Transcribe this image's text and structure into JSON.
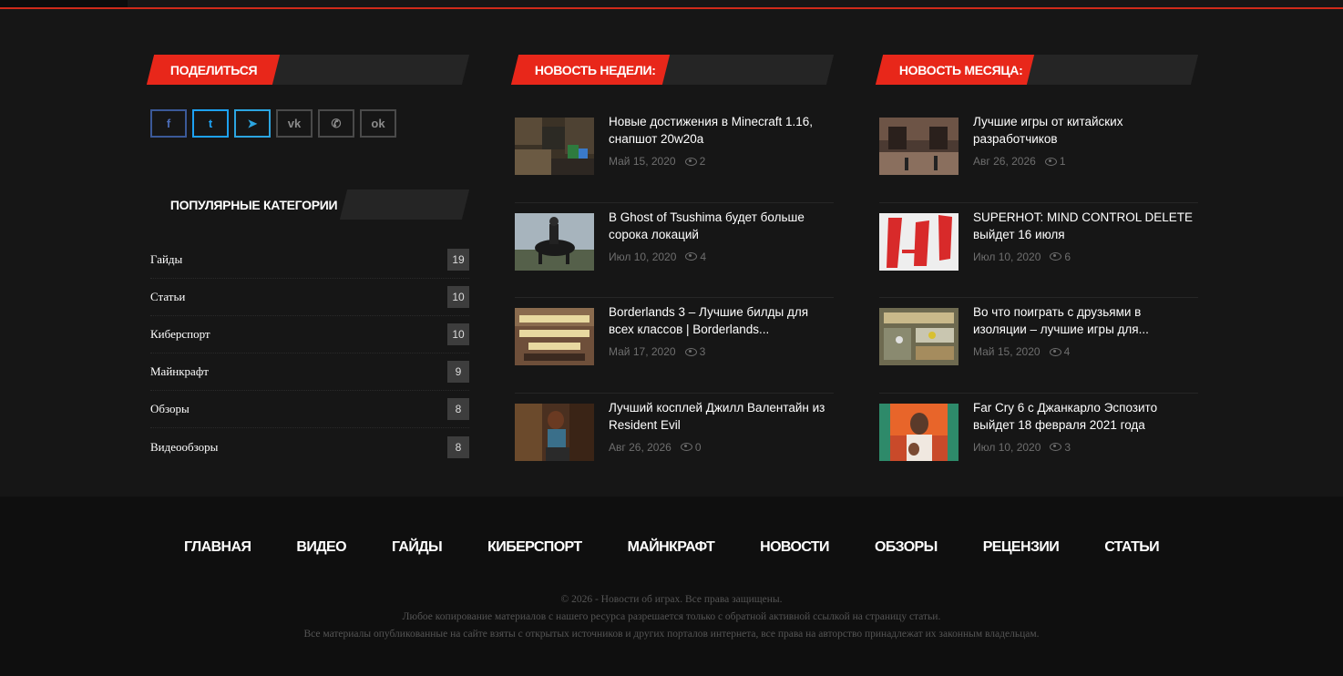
{
  "share": {
    "heading": "ПОДЕЛИТЬСЯ",
    "buttons": [
      {
        "icon": "facebook-icon",
        "glyph": "f"
      },
      {
        "icon": "twitter-icon",
        "glyph": "t"
      },
      {
        "icon": "telegram-icon",
        "glyph": "➤"
      },
      {
        "icon": "vk-icon",
        "glyph": "vk"
      },
      {
        "icon": "viber-icon",
        "glyph": "✆"
      },
      {
        "icon": "odnoklassniki-icon",
        "glyph": "ok"
      }
    ]
  },
  "categories": {
    "heading": "ПОПУЛЯРНЫЕ КАТЕГОРИИ",
    "items": [
      {
        "name": "Гайды",
        "count": "19"
      },
      {
        "name": "Статьи",
        "count": "10"
      },
      {
        "name": "Киберспорт",
        "count": "10"
      },
      {
        "name": "Майнкрафт",
        "count": "9"
      },
      {
        "name": "Обзоры",
        "count": "8"
      },
      {
        "name": "Видеообзоры",
        "count": "8"
      }
    ]
  },
  "week": {
    "heading": "НОВОСТЬ НЕДЕЛИ:",
    "items": [
      {
        "title": "Новые достижения в Minecraft 1.16, снапшот 20w20a",
        "date": "Май 15, 2020",
        "views": "2"
      },
      {
        "title": "В Ghost of Tsushima будет больше сорока локаций",
        "date": "Июл 10, 2020",
        "views": "4"
      },
      {
        "title": "Borderlands 3 – Лучшие билды для всех классов | Borderlands...",
        "date": "Май 17, 2020",
        "views": "3"
      },
      {
        "title": "Лучший косплей Джилл Валентайн из Resident Evil",
        "date": "Авг 26, 2026",
        "views": "0"
      }
    ]
  },
  "month": {
    "heading": "НОВОСТЬ МЕСЯЦА:",
    "items": [
      {
        "title": "Лучшие игры от китайских разработчиков",
        "date": "Авг 26, 2026",
        "views": "1"
      },
      {
        "title": "SUPERHOT: MIND CONTROL DELETE выйдет 16 июля",
        "date": "Июл 10, 2020",
        "views": "6"
      },
      {
        "title": "Во что поиграть с друзьями в изоляции – лучшие игры для...",
        "date": "Май 15, 2020",
        "views": "4"
      },
      {
        "title": "Far Cry 6 с Джанкарло Эспозито выйдет 18 февраля 2021 года",
        "date": "Июл 10, 2020",
        "views": "3"
      }
    ]
  },
  "footer": {
    "nav": [
      "ГЛАВНАЯ",
      "ВИДЕО",
      "ГАЙДЫ",
      "КИБЕРСПОРТ",
      "МАЙНКРАФТ",
      "НОВОСТИ",
      "ОБЗОРЫ",
      "РЕЦЕНЗИИ",
      "СТАТЬИ"
    ],
    "copyright": "© 2026 - Новости об играх. Все права защищены.",
    "copy_notice": "Любое копирование материалов с нашего ресурса разрешается только с обратной активной ссылкой на страницу статьи.",
    "rights_notice": "Все материалы опубликованные на сайте взяты с открытых источников и других порталов интернета, все права на авторство принадлежат их законным владельцам."
  },
  "colors": {
    "accent": "#e8271a",
    "background": "#161616",
    "footer": "#0f0f0f"
  }
}
